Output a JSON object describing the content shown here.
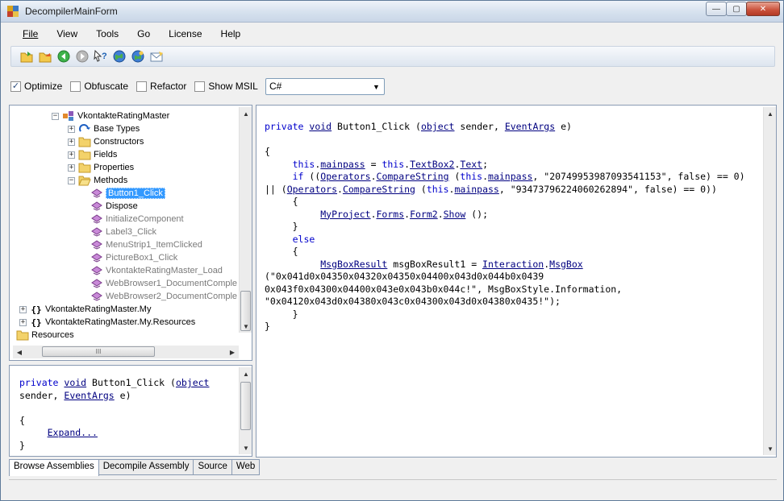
{
  "window": {
    "title": "DecompilerMainForm",
    "controls": {
      "minimize": "—",
      "maximize": "▢",
      "close": "✕"
    }
  },
  "menu": [
    "File",
    "View",
    "Tools",
    "Go",
    "License",
    "Help"
  ],
  "toolbar": {
    "icons": [
      "open-folder-icon",
      "open-assembly-icon",
      "back-icon",
      "forward-icon",
      "help-pointer-icon",
      "globe-icon",
      "globe-refresh-icon",
      "email-icon"
    ]
  },
  "options": {
    "optimize": {
      "label": "Optimize",
      "checked": true
    },
    "obfuscate": {
      "label": "Obfuscate",
      "checked": false
    },
    "refactor": {
      "label": "Refactor",
      "checked": false
    },
    "show_msil": {
      "label": "Show MSIL",
      "checked": false
    },
    "language": "C#"
  },
  "tree": {
    "root_class": "VkontakteRatingMaster",
    "folders": [
      "Base Types",
      "Constructors",
      "Fields",
      "Properties",
      "Methods"
    ],
    "methods": [
      "Button1_Click",
      "Dispose",
      "InitializeComponent",
      "Label3_Click",
      "MenuStrip1_ItemClicked",
      "PictureBox1_Click",
      "VkontakteRatingMaster_Load",
      "WebBrowser1_DocumentComple",
      "WebBrowser2_DocumentComple"
    ],
    "namespaces": [
      "VkontakteRatingMaster.My",
      "VkontakteRatingMaster.My.Resources"
    ],
    "resources": "Resources",
    "hscroll_grip": "III"
  },
  "preview": {
    "expand": "Expand..."
  },
  "code": {
    "l1": {
      "kw1": "private",
      "kw2": "void",
      "name": "Button1_Click",
      "p1": "(",
      "t1": "object",
      "p2": "sender,",
      "t2": "EventArgs",
      "p3": "e)"
    },
    "open": "{",
    "l3": {
      "kw": "this",
      "f": "mainpass",
      "eq": " = ",
      "kw2": "this",
      "f2": "TextBox2",
      "f3": "Text",
      "end": ";"
    },
    "l4": {
      "kw": "if",
      "a": " ((",
      "c1": "Operators",
      "m": "CompareString",
      "b": " (",
      "kw2": "this",
      "f": "mainpass",
      "s": ", \"20749953987093541153\", false) == 0)"
    },
    "l5": {
      "a": "|| (",
      "c1": "Operators",
      "m": "CompareString",
      "b": " (",
      "kw2": "this",
      "f": "mainpass",
      "s": ", \"93473796224060262894\", false) == 0))"
    },
    "brace_open": "{",
    "l7": {
      "c1": "MyProject",
      "c2": "Forms",
      "c3": "Form2",
      "m": "Show",
      "end": " ();"
    },
    "brace_close": "}",
    "else": "else",
    "l10": {
      "t": "MsgBoxResult",
      "v": " msgBoxResult1 = ",
      "c": "Interaction",
      "m": "MsgBox"
    },
    "l11": "(\"0x041d0x04350x04320x04350x04400x043d0x044b0x0439",
    "l12": "0x043f0x04300x04400x043e0x043b0x044c!\", MsgBoxStyle.Information,",
    "l13": "\"0x04120x043d0x04380x043c0x04300x043d0x04380x0435!\");",
    "close": "}"
  },
  "tabs": [
    "Browse Assemblies",
    "Decompile Assembly",
    "Source",
    "Web"
  ],
  "colors": {
    "keyword": "#0000cc",
    "reference": "#000080",
    "selection": "#3399ff"
  }
}
